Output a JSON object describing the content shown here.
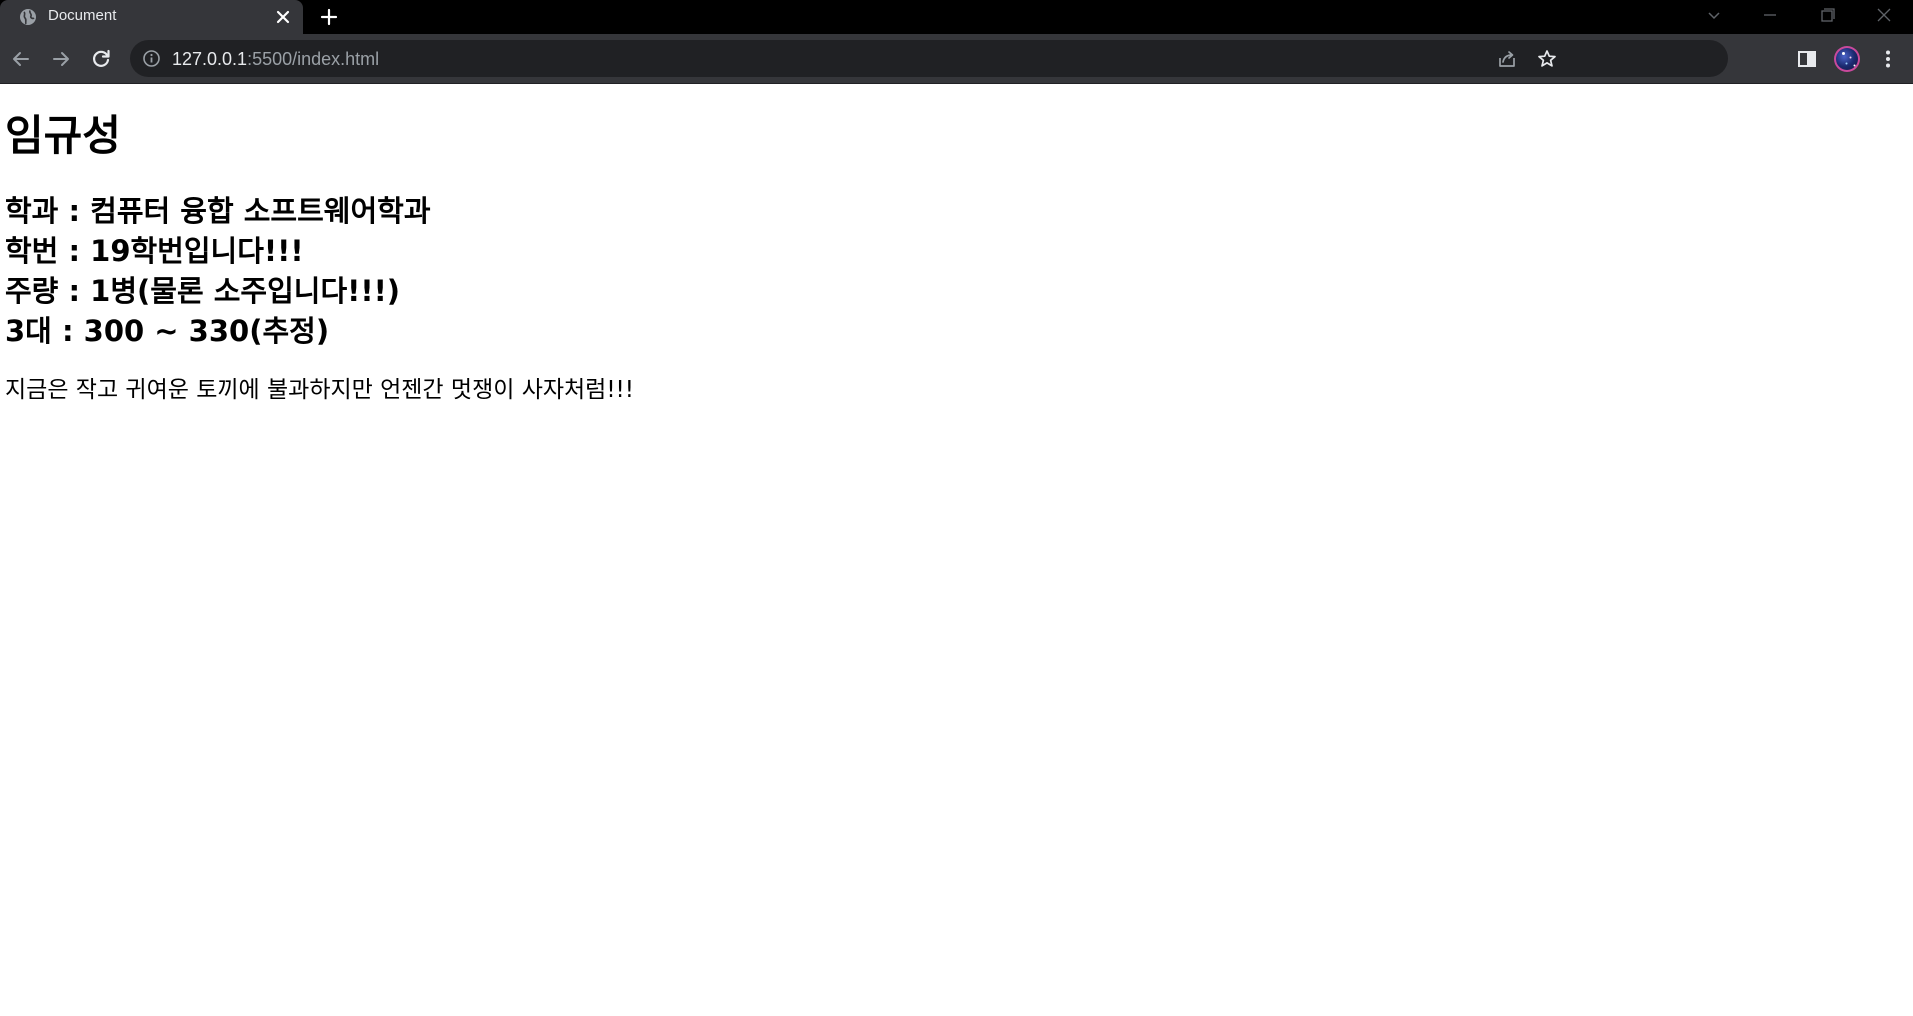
{
  "browser": {
    "tab": {
      "title": "Document",
      "favicon": "globe-icon",
      "close_icon": "close-icon"
    },
    "new_tab_icon": "plus-icon",
    "window_controls": [
      "chevron-down-icon",
      "minimize-icon",
      "restore-icon",
      "close-icon"
    ],
    "address_bar": {
      "url_host": "127.0.0.1",
      "url_path": ":5500/index.html",
      "site_info_icon": "info-icon"
    },
    "toolbar_icons": [
      "back-arrow-icon",
      "forward-arrow-icon",
      "reload-icon",
      "share-icon",
      "bookmark-star-icon",
      "side-panel-icon",
      "profile-avatar",
      "more-menu-icon"
    ],
    "colors": {
      "tabbar_bg": "#000000",
      "toolbar_bg": "#35363a",
      "omnibox_bg": "#202124",
      "text_light": "#e8eaed",
      "text_dim": "#9aa0a6"
    }
  },
  "page": {
    "title": "임규성",
    "info_lines": [
      "학과 : 컴퓨터 융합 소프트웨어학과",
      "학번 : 19학번입니다!!!",
      "주량 : 1병(물론 소주입니다!!!)",
      "3대 : 300 ~ 330(추정)"
    ],
    "motto": "지금은 작고 귀여운 토끼에 불과하지만 언젠간 멋쟁이 사자처럼!!!",
    "colors": {
      "background": "#ffffff",
      "text": "#000000"
    }
  }
}
